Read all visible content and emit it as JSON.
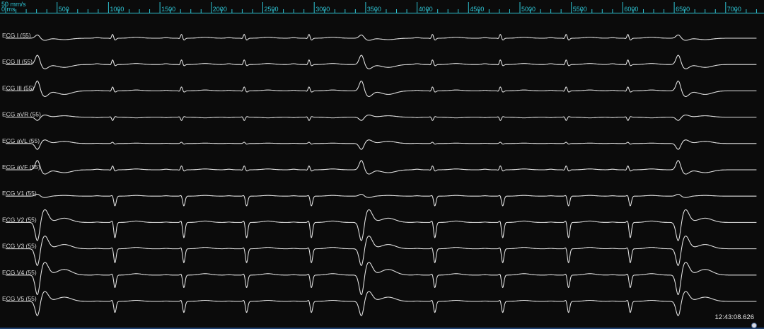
{
  "colors": {
    "background": "#0b0b0b",
    "trace": "#e6e6e6",
    "ruler": "#2ec4d4",
    "label": "#d8d8d8"
  },
  "ruler": {
    "scale_label": "50 mm/s",
    "origin_label": "0 ms",
    "labels": [
      {
        "ms": 500,
        "text": "500"
      },
      {
        "ms": 1000,
        "text": "1000"
      },
      {
        "ms": 1500,
        "text": "1500"
      },
      {
        "ms": 2000,
        "text": "2000"
      },
      {
        "ms": 2500,
        "text": "2500"
      },
      {
        "ms": 3000,
        "text": "3000"
      },
      {
        "ms": 3500,
        "text": "3500"
      },
      {
        "ms": 4000,
        "text": "4000"
      },
      {
        "ms": 4500,
        "text": "4500"
      },
      {
        "ms": 5000,
        "text": "5000"
      },
      {
        "ms": 5500,
        "text": "5500"
      },
      {
        "ms": 6000,
        "text": "6000"
      },
      {
        "ms": 6500,
        "text": "6500"
      },
      {
        "ms": 7000,
        "text": "7000"
      }
    ]
  },
  "timestamp": "12:43:08.626",
  "chart_data": {
    "type": "line",
    "x_unit": "ms",
    "xlim": [
      0,
      7300
    ],
    "beats_ms": [
      {
        "t": 310,
        "kind": "pvc"
      },
      {
        "t": 1040,
        "kind": "normal"
      },
      {
        "t": 1710,
        "kind": "normal"
      },
      {
        "t": 2320,
        "kind": "normal"
      },
      {
        "t": 2950,
        "kind": "normal"
      },
      {
        "t": 3460,
        "kind": "pvc"
      },
      {
        "t": 4150,
        "kind": "normal"
      },
      {
        "t": 4810,
        "kind": "normal"
      },
      {
        "t": 5450,
        "kind": "normal"
      },
      {
        "t": 6050,
        "kind": "normal"
      },
      {
        "t": 6540,
        "kind": "pvc"
      }
    ],
    "series": [
      {
        "name": "ECG I (55)"
      },
      {
        "name": "ECG II (55)"
      },
      {
        "name": "ECG III (55)"
      },
      {
        "name": "ECG aVR (55)"
      },
      {
        "name": "ECG aVL (55)"
      },
      {
        "name": "ECG aVF (55)"
      },
      {
        "name": "ECG V1 (55)"
      },
      {
        "name": "ECG V2 (55)"
      },
      {
        "name": "ECG V3 (55)"
      },
      {
        "name": "ECG V4 (55)"
      },
      {
        "name": "ECG V5 (55)"
      }
    ]
  }
}
